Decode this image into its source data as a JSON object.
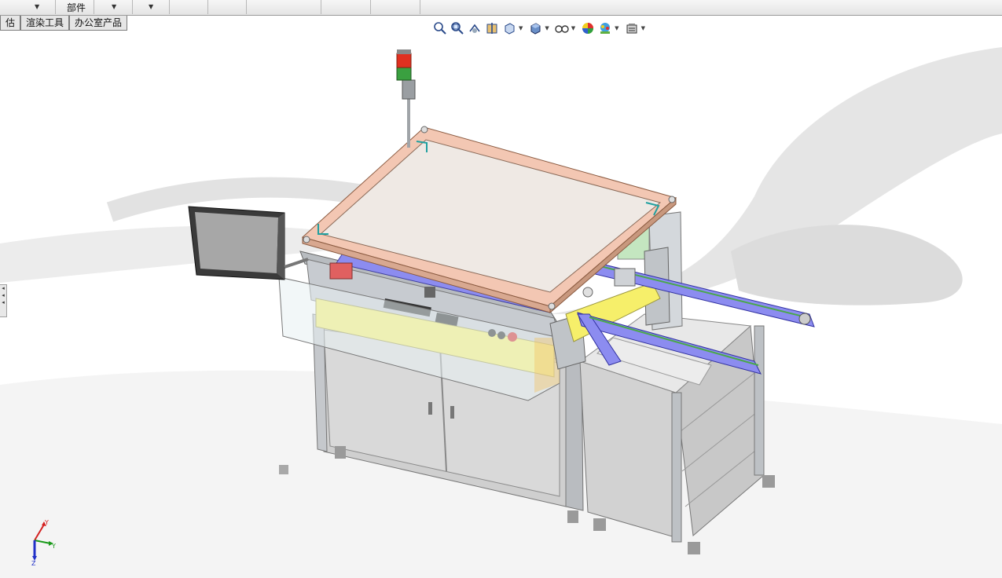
{
  "ribbon": {
    "visible_label": "部件"
  },
  "command_tabs": [
    {
      "label": "估",
      "active": false
    },
    {
      "label": "渲染工具",
      "active": false
    },
    {
      "label": "办公室产品",
      "active": false
    }
  ],
  "heads_up_toolbar": [
    {
      "icon": "zoom-to-fit-icon"
    },
    {
      "icon": "zoom-to-area-icon"
    },
    {
      "icon": "previous-view-icon"
    },
    {
      "icon": "section-view-icon"
    },
    {
      "icon": "view-orientation-icon"
    },
    {
      "icon": "display-style-icon"
    },
    {
      "icon": "hide-show-items-icon"
    },
    {
      "icon": "edit-appearance-icon"
    },
    {
      "icon": "apply-scene-icon"
    },
    {
      "icon": "view-settings-icon"
    }
  ],
  "triad": {
    "axes": [
      "Y",
      "Y",
      "Z"
    ],
    "colors": {
      "x": "#d42020",
      "y": "#1a9a1a",
      "z": "#2030c8"
    }
  },
  "scene": {
    "subject": "automated machine assembly model",
    "colors": {
      "cover": "#f3c7b3",
      "conveyor": "#8c8cf0",
      "panel": "#f6ef6a",
      "cabinet": "#d7d7d7",
      "frame": "#c0c4c8",
      "glass": "#e7f1f2",
      "beacon_red": "#e03020",
      "beacon_green": "#3aa040",
      "background_swirl": "#e4e4e4"
    }
  }
}
